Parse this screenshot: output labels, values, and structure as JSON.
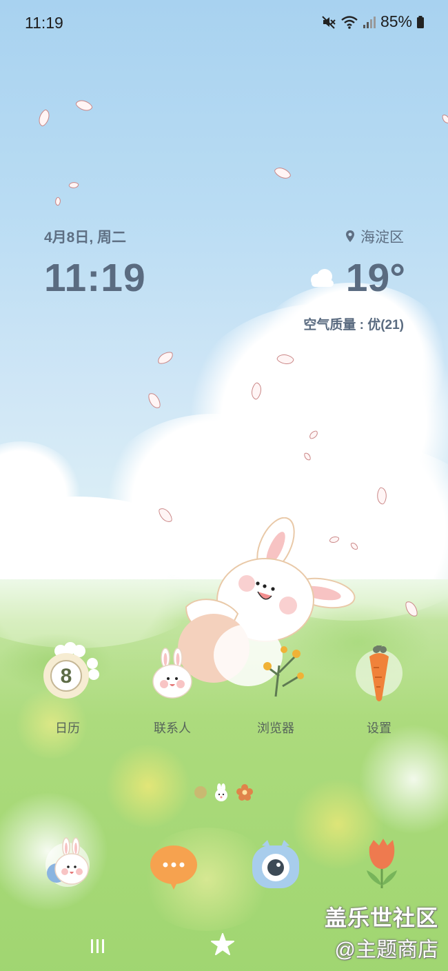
{
  "status_bar": {
    "time": "11:19",
    "battery": "85%",
    "icons": [
      "mute-icon",
      "wifi-icon",
      "signal-icon",
      "battery-icon"
    ]
  },
  "widget": {
    "date": "4月8日, 周二",
    "time": "11:19",
    "location": "海淀区",
    "temperature": "19°",
    "air_quality": "空气质量 : 优(21)",
    "weather_icon": "cloud-icon"
  },
  "apps": [
    {
      "label": "日历",
      "badge": "8",
      "icon": "calendar-icon"
    },
    {
      "label": "联系人",
      "icon": "contacts-icon"
    },
    {
      "label": "浏览器",
      "icon": "browser-icon"
    },
    {
      "label": "设置",
      "icon": "settings-icon"
    }
  ],
  "dock": [
    {
      "icon": "phone-icon"
    },
    {
      "icon": "messages-icon",
      "text": "···"
    },
    {
      "icon": "camera-icon"
    },
    {
      "icon": "gallery-icon"
    }
  ],
  "page_indicator": {
    "pages": 3,
    "current": 2
  },
  "watermark": {
    "line1": "盖乐世社区",
    "line2": "@主题商店"
  },
  "nav_bar": {
    "icons": [
      "recent-apps-icon",
      "home-icon"
    ]
  },
  "colors": {
    "widget_text": "#5a6b80",
    "sky": "#a8d2f0",
    "grass": "#b8df95"
  }
}
